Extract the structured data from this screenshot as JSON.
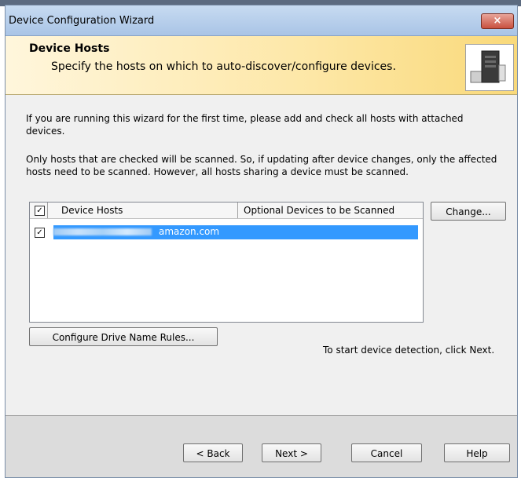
{
  "window": {
    "title": "Device Configuration Wizard",
    "close_glyph": "×"
  },
  "header": {
    "title": "Device Hosts",
    "subtitle": "Specify the hosts on which to auto-discover/configure devices.",
    "icon": "server-icon"
  },
  "body": {
    "paragraph1": "If you are running this wizard for the first time, please add and check all hosts with attached devices.",
    "paragraph2": "Only hosts that are checked will be scanned.  So, if updating after device changes, only the affected hosts need to be scanned.  However, all hosts sharing a device must be scanned."
  },
  "hosts_list": {
    "columns": [
      "Device Hosts",
      "Optional Devices to be Scanned"
    ],
    "header_checked": true,
    "rows": [
      {
        "checked": true,
        "host_visible_suffix": "amazon.com",
        "optional_devices": "",
        "selected": true
      }
    ]
  },
  "buttons": {
    "change": "Change...",
    "configure_rules": "Configure Drive Name Rules...",
    "back": "< Back",
    "next": "Next >",
    "cancel": "Cancel",
    "help": "Help"
  },
  "hint": "To start device detection, click Next."
}
